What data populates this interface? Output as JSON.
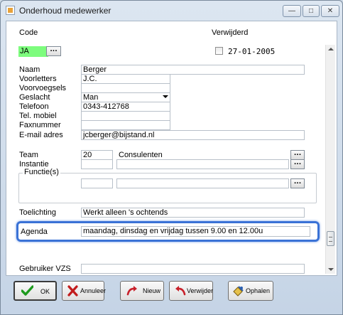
{
  "window": {
    "title": "Onderhoud medewerker"
  },
  "controls": {
    "minimize": "—",
    "maximize": "□",
    "close": "✕"
  },
  "form": {
    "code_label": "Code",
    "code_value": "JA",
    "lookup_label": "...",
    "deleted_label": "Verwijderd",
    "deleted_checked": false,
    "deleted_date": "27-01-2005",
    "naam_label": "Naam",
    "naam_value": "Berger",
    "voorletters_label": "Voorletters",
    "voorletters_value": "J.C.",
    "voorvoegsels_label": "Voorvoegsels",
    "voorvoegsels_value": "",
    "geslacht_label": "Geslacht",
    "geslacht_value": "Man",
    "telefoon_label": "Telefoon",
    "telefoon_value": "0343-412768",
    "mobiel_label": "Tel. mobiel",
    "mobiel_value": "",
    "fax_label": "Faxnummer",
    "fax_value": "",
    "email_label": "E-mail adres",
    "email_value": "jcberger@bijstand.nl",
    "team_label": "Team",
    "team_code": "20",
    "team_name": "Consulenten",
    "instantie_label": "Instantie",
    "instantie_code": "",
    "instantie_name": "",
    "functies_label": "Functie(s)",
    "functie_code": "",
    "functie_name": "",
    "toelichting_label": "Toelichting",
    "toelichting_value": "Werkt alleen 's ochtends",
    "agenda_label": "Agenda",
    "agenda_value": "maandag, dinsdag en vrijdag tussen 9.00 en 12.00u",
    "gebruiker_label": "Gebruiker VZS",
    "gebruiker_value": ""
  },
  "buttons": {
    "ok": "OK",
    "annuleer": "Annuleer",
    "nieuw": "Nieuw",
    "verwijder": "Verwijder",
    "ophalen": "Ophalen"
  },
  "colors": {
    "code_highlight": "#7dfc7d",
    "focus_highlight": "#3a72d6",
    "ok_check": "#1e9a1e",
    "cancel_x": "#c21b1b",
    "arrow_red": "#c8202a"
  },
  "icons": {
    "ok": "checkmark-icon",
    "annuleer": "cancel-x-icon",
    "nieuw": "new-arrow-icon",
    "verwijder": "delete-arrow-icon",
    "ophalen": "fetch-icon"
  }
}
